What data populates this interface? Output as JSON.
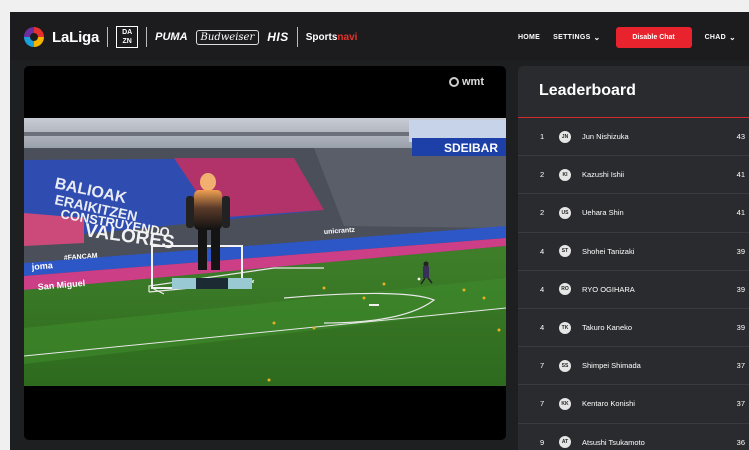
{
  "header": {
    "brand": "LaLiga",
    "sponsors": {
      "dazn": "DA ZN",
      "puma": "PUMA",
      "budweiser": "Budweiser",
      "his": "HIS",
      "sportsnavi_a": "Sports",
      "sportsnavi_b": "navi"
    },
    "nav": {
      "home": "HOME",
      "settings": "SETTINGS",
      "chat_button": "Disable Chat",
      "user": "CHAD"
    }
  },
  "video": {
    "watermark": "wmt",
    "stadium_banners": [
      "BALIOAK",
      "ERAIKITZEN",
      "CONSTRUYENDO",
      "VALORES",
      "SDEIBAR",
      "#FANCAM",
      "joma",
      "San Miguel",
      "unicrantz"
    ]
  },
  "leaderboard": {
    "title": "Leaderboard",
    "entries": [
      {
        "rank": "1",
        "initials": "JN",
        "name": "Jun Nishizuka",
        "score": "43"
      },
      {
        "rank": "2",
        "initials": "KI",
        "name": "Kazushi Ishii",
        "score": "41"
      },
      {
        "rank": "2",
        "initials": "US",
        "name": "Uehara Shin",
        "score": "41"
      },
      {
        "rank": "4",
        "initials": "ST",
        "name": "Shohei Tanizaki",
        "score": "39"
      },
      {
        "rank": "4",
        "initials": "RO",
        "name": "RYO OGIHARA",
        "score": "39"
      },
      {
        "rank": "4",
        "initials": "TK",
        "name": "Takuro Kaneko",
        "score": "39"
      },
      {
        "rank": "7",
        "initials": "SS",
        "name": "Shimpei Shimada",
        "score": "37"
      },
      {
        "rank": "7",
        "initials": "KK",
        "name": "Kentaro Konishi",
        "score": "37"
      },
      {
        "rank": "9",
        "initials": "AT",
        "name": "Atsushi Tsukamoto",
        "score": "36"
      }
    ]
  },
  "colors": {
    "accent": "#e8232d",
    "background": "#1e1f21",
    "panel": "#2a2b2e"
  }
}
